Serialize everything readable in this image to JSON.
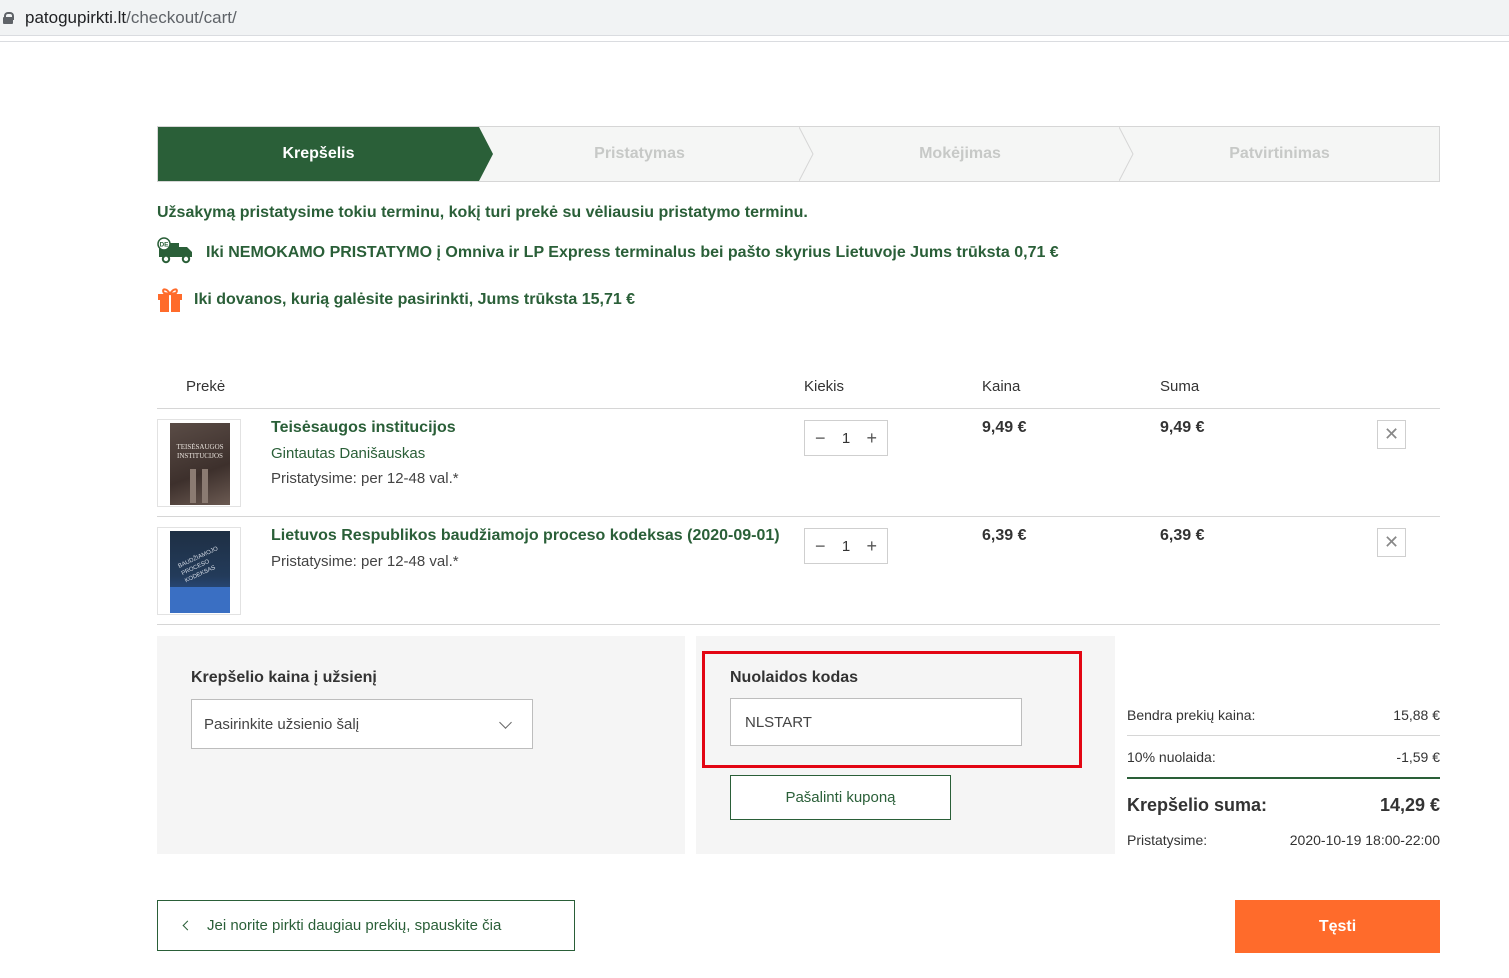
{
  "browser": {
    "url_host": "patogupirkti.lt",
    "url_path": "/checkout/cart/"
  },
  "steps": [
    "Krepšelis",
    "Pristatymas",
    "Mokėjimas",
    "Patvirtinimas"
  ],
  "notice": "Užsakymą pristatysime tokiu terminu, kokį turi prekė su vėliausiu pristatymo terminu.",
  "promos": {
    "free_delivery": "Iki NEMOKAMO PRISTATYMO į Omniva ir LP Express terminalus bei pašto skyrius Lietuvoje Jums trūksta 0,71 €",
    "gift": "Iki dovanos, kurią galėsite pasirinkti, Jums trūksta 15,71 €",
    "truck_icon_badge": "DE",
    "colors": {
      "green": "#2a5f38",
      "orange": "#ff6b2b"
    }
  },
  "table": {
    "headers": {
      "item": "Prekė",
      "qty": "Kiekis",
      "price": "Kaina",
      "sum": "Suma"
    },
    "rows": [
      {
        "title": "Teisėsaugos institucijos",
        "author": "Gintautas Danišauskas",
        "delivery": "Pristatysime: per 12-48 val.*",
        "qty": "1",
        "price": "9,49 €",
        "sum": "9,49 €",
        "cover_text": "TEISĖSAUGOS INSTITUCIJOS"
      },
      {
        "title": "Lietuvos Respublikos baudžiamojo proceso kodeksas (2020-09-01)",
        "delivery": "Pristatysime: per 12-48 val.*",
        "qty": "1",
        "price": "6,39 €",
        "sum": "6,39 €",
        "cover_text": "BAUDŽIAMOJO PROCESO KODEKSAS"
      }
    ],
    "minus": "−",
    "plus": "+",
    "remove": "✕"
  },
  "foreign": {
    "label": "Krepšelio kaina į užsienį",
    "select_value": "Pasirinkite užsienio šalį"
  },
  "discount": {
    "label": "Nuolaidos kodas",
    "code_value": "NLSTART",
    "remove_button": "Pašalinti kuponą"
  },
  "summary": {
    "subtotal_label": "Bendra prekių kaina:",
    "subtotal_value": "15,88 €",
    "discount_label": "10% nuolaida:",
    "discount_value": "-1,59 €",
    "total_label": "Krepšelio suma:",
    "total_value": "14,29 €",
    "delivery_label": "Pristatysime:",
    "delivery_value": "2020-10-19 18:00-22:00"
  },
  "actions": {
    "back": "Jei norite pirkti daugiau prekių, spauskite čia",
    "continue": "Tęsti"
  }
}
